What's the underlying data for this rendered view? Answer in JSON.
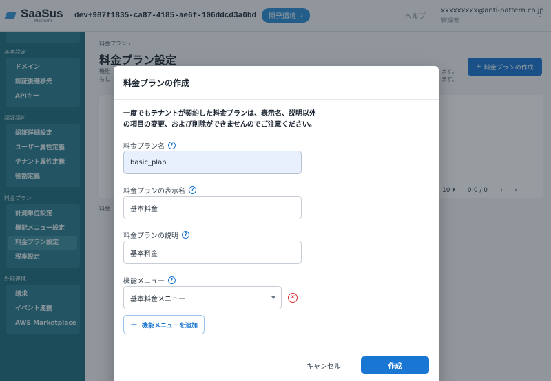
{
  "header": {
    "logo_title": "SaaSus",
    "logo_sub": "Platform",
    "env_id": "dev+987f1835-ca87-4185-ae6f-106ddcd3a0bd",
    "env_badge": "開発環境",
    "help": "ヘルプ",
    "user_email": "xxxxxxxxx@anti-pattern.co.jp",
    "user_role": "管理者"
  },
  "sidebar": {
    "groups": [
      {
        "label": "基本設定",
        "items": [
          "ドメイン",
          "認証後遷移先",
          "APIキー"
        ]
      },
      {
        "label": "認証認可",
        "items": [
          "認証詳細設定",
          "ユーザー属性定義",
          "テナント属性定義",
          "役割定義"
        ]
      },
      {
        "label": "料金プラン",
        "items": [
          "計測単位設定",
          "機能メニュー設定",
          "料金プラン設定",
          "税率設定"
        ]
      },
      {
        "label": "外部連携",
        "items": [
          "請求",
          "イベント連携",
          "AWS Marketplace"
        ]
      }
    ]
  },
  "page": {
    "breadcrumb": "料金プラン ›",
    "title": "料金プラン設定",
    "desc_line1": "機能",
    "desc_line2": "もし",
    "desc_tail1": "ます。",
    "desc_tail2": "ます。",
    "create_button": "料金プランの作成",
    "rows_per_page": "10",
    "range": "0-0 / 0",
    "panel_label": "料金"
  },
  "dialog": {
    "title": "料金プランの作成",
    "warning_line1": "一度でもテナントが契約した料金プランは、表示名、説明以外",
    "warning_line2": "の項目の変更、および削除ができませんのでご注意ください。",
    "fields": {
      "name_label": "料金プラン名",
      "name_value": "basic_plan",
      "display_label": "料金プランの表示名",
      "display_value": "基本料金",
      "description_label": "料金プランの説明",
      "description_value": "基本料金",
      "menu_label": "機能メニュー",
      "menu_value": "基本料金メニュー"
    },
    "add_menu_button": "機能メニューを追加",
    "cancel_button": "キャンセル",
    "submit_button": "作成"
  },
  "colors": {
    "primary": "#1976d2",
    "sidebar": "#1f6d80",
    "danger": "#d32f2f"
  }
}
